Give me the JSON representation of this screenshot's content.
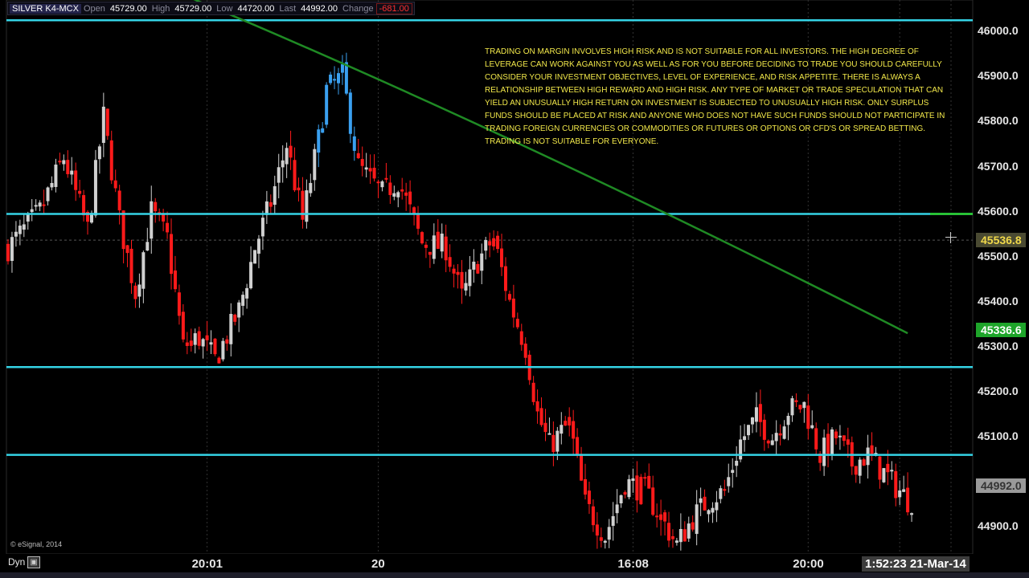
{
  "header": {
    "symbol": "SILVER K4-MCX",
    "open_label": "Open",
    "open_value": "45729.00",
    "high_label": "High",
    "high_value": "45729.00",
    "low_label": "Low",
    "low_value": "44720.00",
    "last_label": "Last",
    "last_value": "44992.00",
    "change_label": "Change",
    "change_value": "-681.00"
  },
  "disclaimer": "TRADING ON MARGIN INVOLVES HIGH RISK AND IS NOT SUITABLE FOR ALL INVESTORS. THE HIGH DEGREE OF LEVERAGE CAN WORK AGAINST YOU AS WELL AS FOR YOU BEFORE DECIDING TO TRADE YOU SHOULD CAREFULLY CONSIDER YOUR INVESTMENT OBJECTIVES, LEVEL OF EXPERIENCE, AND RISK APPETITE. THERE IS ALWAYS A RELATIONSHIP BETWEEN HIGH REWARD AND HIGH RISK. ANY TYPE OF MARKET OR TRADE SPECULATION THAT CAN YIELD AN UNUSUALLY HIGH RETURN ON INVESTMENT IS SUBJECTED TO UNUSUALLY HIGH RISK. ONLY SURPLUS FUNDS SHOULD BE PLACED AT RISK AND ANYONE WHO DOES NOT HAVE SUCH FUNDS SHOULD NOT PARTICIPATE IN TRADING FOREIGN CURRENCIES OR COMMODITIES OR FUTURES OR OPTIONS OR CFD'S OR SPREAD BETTING. TRADING IS NOT SUITABLE FOR EVERYONE.",
  "copyright": "© eSignal, 2014",
  "footer": {
    "dyn_label": "Dyn",
    "clock": "1:52:23 21-Mar-14"
  },
  "colors": {
    "up_candle": "#d0d0d0",
    "down_candle": "#ff1a1a",
    "highlight_candle": "#3aa0f0",
    "level_line": "#35d4e6",
    "trend_line": "#1f8a24"
  },
  "chart_data": {
    "type": "candlestick",
    "y_ticks": [
      "46000.0",
      "45900.0",
      "45800.0",
      "45700.0",
      "45600.0",
      "45500.0",
      "45400.0",
      "45300.0",
      "45200.0",
      "45100.0",
      "44900.0"
    ],
    "x_ticks": [
      {
        "label": "20:01",
        "index": 50
      },
      {
        "label": "20",
        "index": 93
      },
      {
        "label": "16:08",
        "index": 157
      },
      {
        "label": "20:00",
        "index": 201
      }
    ],
    "ylim": [
      44840,
      46070
    ],
    "grid": true,
    "horizontal_levels": [
      46025,
      45595,
      45255,
      45060
    ],
    "trend_line": {
      "from": [
        39,
        46100
      ],
      "to": [
        226,
        45330
      ]
    },
    "price_tags": [
      {
        "label": "45536.8",
        "value": 45536.8,
        "style": "gold"
      },
      {
        "label": "45336.6",
        "value": 45336.6,
        "style": "green"
      },
      {
        "label": "44992.0",
        "value": 44992.0,
        "style": "gray"
      }
    ],
    "anchors": [
      [
        0,
        45520
      ],
      [
        8,
        45600
      ],
      [
        14,
        45720
      ],
      [
        20,
        45560
      ],
      [
        24,
        45810
      ],
      [
        28,
        45580
      ],
      [
        32,
        45420
      ],
      [
        36,
        45600
      ],
      [
        40,
        45540
      ],
      [
        44,
        45300
      ],
      [
        48,
        45320
      ],
      [
        52,
        45270
      ],
      [
        58,
        45380
      ],
      [
        62,
        45520
      ],
      [
        66,
        45620
      ],
      [
        70,
        45750
      ],
      [
        74,
        45580
      ],
      [
        78,
        45760
      ],
      [
        80,
        45870
      ],
      [
        84,
        45900
      ],
      [
        88,
        45700
      ],
      [
        94,
        45640
      ],
      [
        98,
        45670
      ],
      [
        104,
        45530
      ],
      [
        110,
        45520
      ],
      [
        114,
        45410
      ],
      [
        118,
        45490
      ],
      [
        122,
        45540
      ],
      [
        126,
        45400
      ],
      [
        130,
        45300
      ],
      [
        133,
        45150
      ],
      [
        136,
        45080
      ],
      [
        141,
        45130
      ],
      [
        145,
        44950
      ],
      [
        150,
        44880
      ],
      [
        155,
        45000
      ],
      [
        160,
        44980
      ],
      [
        164,
        44920
      ],
      [
        168,
        44860
      ],
      [
        172,
        44920
      ],
      [
        176,
        44960
      ],
      [
        180,
        44980
      ],
      [
        184,
        45090
      ],
      [
        188,
        45140
      ],
      [
        192,
        45100
      ],
      [
        196,
        45160
      ],
      [
        200,
        45170
      ],
      [
        204,
        45060
      ],
      [
        208,
        45100
      ],
      [
        212,
        45040
      ],
      [
        216,
        45060
      ],
      [
        220,
        45020
      ],
      [
        226,
        44960
      ]
    ],
    "highlight_index_range": [
      78,
      93
    ]
  }
}
